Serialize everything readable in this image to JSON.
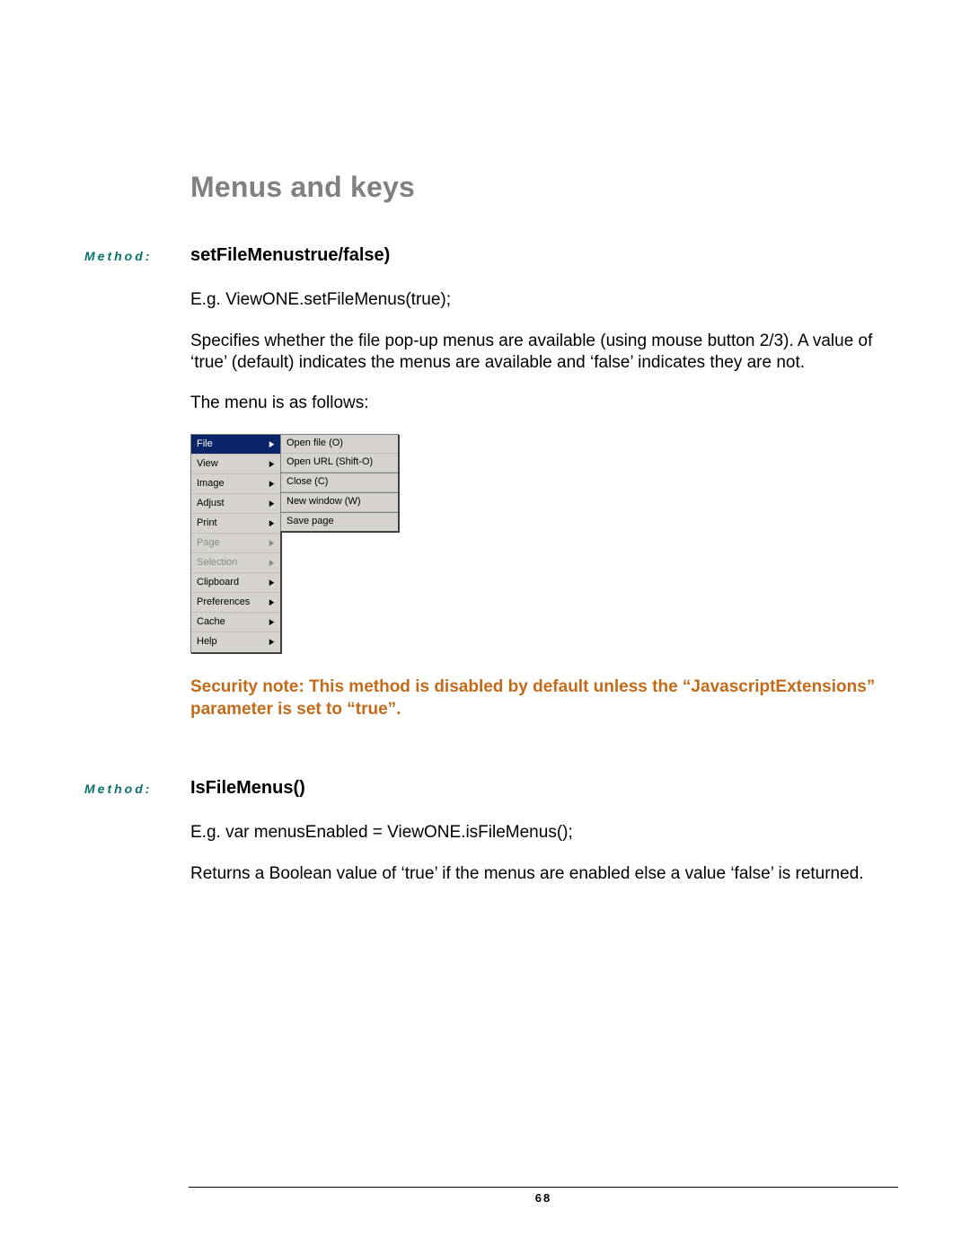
{
  "section_title": "Menus and keys",
  "method1": {
    "label": "Method:",
    "name": "setFileMenustrue/false)",
    "example": "E.g. ViewONE.setFileMenus(true);",
    "desc": "Specifies whether the file pop-up menus are available (using mouse button 2/3). A value of ‘true’ (default) indicates the menus are available and ‘false’ indicates they are not.",
    "menu_intro": "The menu is as follows:",
    "security_note": "Security note: This method is disabled by default unless the “JavascriptExtensions” parameter is set to “true”."
  },
  "menu": {
    "main": [
      {
        "label": "File",
        "state": "selected"
      },
      {
        "label": "View",
        "state": ""
      },
      {
        "label": "Image",
        "state": ""
      },
      {
        "label": "Adjust",
        "state": ""
      },
      {
        "label": "Print",
        "state": ""
      },
      {
        "label": "Page",
        "state": "disabled"
      },
      {
        "label": "Selection",
        "state": "disabled"
      },
      {
        "label": "Clipboard",
        "state": ""
      },
      {
        "label": "Preferences",
        "state": ""
      },
      {
        "label": "Cache",
        "state": ""
      },
      {
        "label": "Help",
        "state": ""
      }
    ],
    "sub": [
      "Open file (O)",
      "Open URL (Shift-O)",
      "Close (C)",
      "New window (W)",
      "Save page"
    ]
  },
  "method2": {
    "label": "Method:",
    "name": "IsFileMenus()",
    "example": "E.g. var menusEnabled = ViewONE.isFileMenus();",
    "desc": "Returns a Boolean value of ‘true’ if the menus are enabled else a value ‘false’ is returned."
  },
  "page_number": "68"
}
